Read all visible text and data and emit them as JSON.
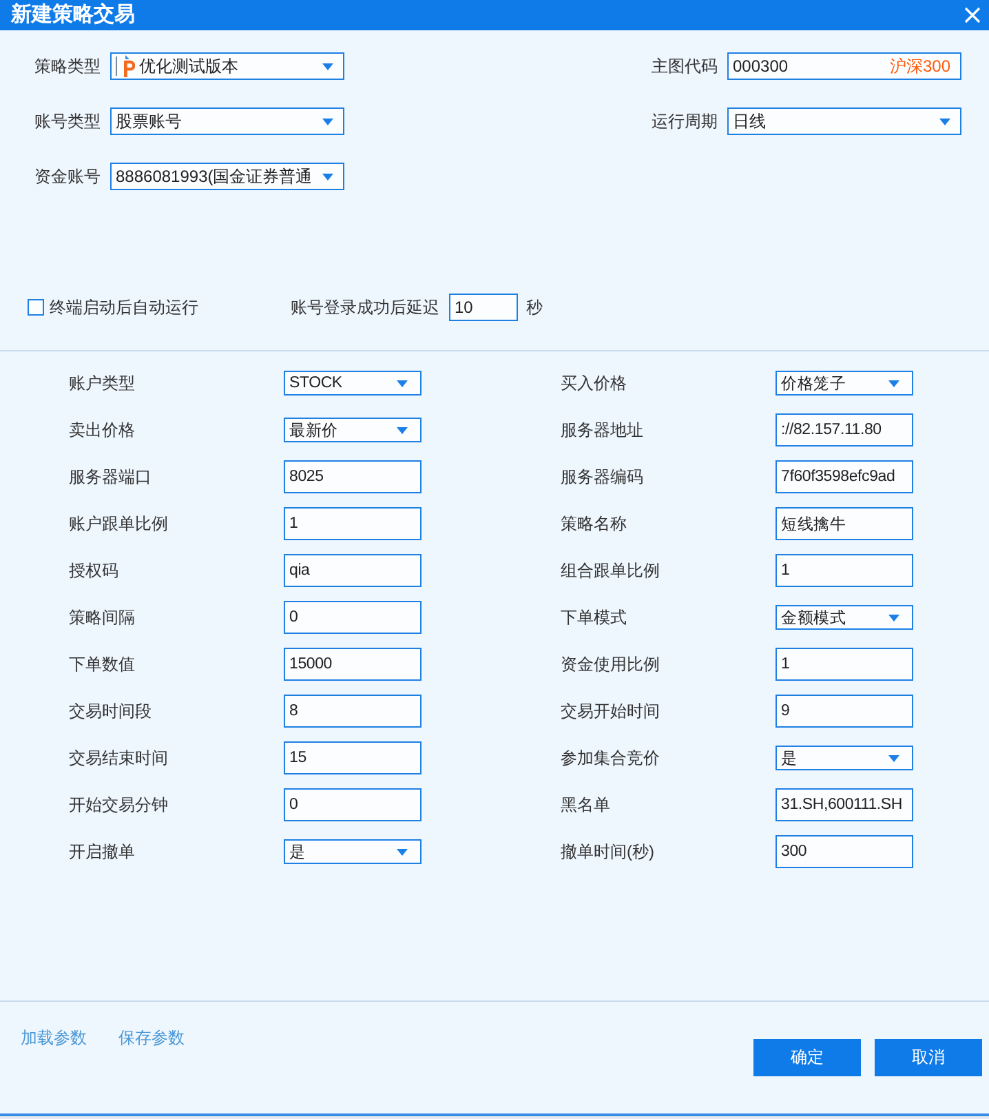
{
  "window": {
    "title": "新建策略交易"
  },
  "top_form": [
    [
      {
        "label": "策略类型",
        "kind": "dropdown",
        "icon": true,
        "value": "优化测试版本"
      },
      {
        "label": "主图代码",
        "kind": "input",
        "icon": false,
        "value": "000300",
        "suffix": "沪深300"
      }
    ],
    [
      {
        "label": "账号类型",
        "kind": "dropdown",
        "icon": false,
        "value": "股票账号"
      },
      {
        "label": "运行周期",
        "kind": "dropdown",
        "icon": false,
        "value": "日线"
      }
    ],
    [
      {
        "label": "资金账号",
        "kind": "dropdown",
        "icon": false,
        "value": "8886081993(国金证券普通"
      }
    ]
  ],
  "auto_run": {
    "label": "终端启动后自动运行",
    "checked": false
  },
  "login_delay": {
    "label": "账号登录成功后延迟",
    "value": "10",
    "unit": "秒"
  },
  "params": [
    {
      "label": "账户类型",
      "kind": "dropdown",
      "value": "STOCK"
    },
    {
      "label": "买入价格",
      "kind": "dropdown",
      "value": "价格笼子"
    },
    {
      "label": "卖出价格",
      "kind": "dropdown",
      "value": "最新价"
    },
    {
      "label": "服务器地址",
      "kind": "input",
      "value": "://82.157.11.80"
    },
    {
      "label": "服务器端口",
      "kind": "input",
      "value": "8025"
    },
    {
      "label": "服务器编码",
      "kind": "input",
      "value": "7f60f3598efc9ad"
    },
    {
      "label": "账户跟单比例",
      "kind": "input",
      "value": "1"
    },
    {
      "label": "策略名称",
      "kind": "input",
      "value": "短线擒牛"
    },
    {
      "label": "授权码",
      "kind": "input",
      "value": "qia"
    },
    {
      "label": "组合跟单比例",
      "kind": "input",
      "value": "1"
    },
    {
      "label": "策略间隔",
      "kind": "input",
      "value": "0"
    },
    {
      "label": "下单模式",
      "kind": "dropdown",
      "value": "金额模式"
    },
    {
      "label": "下单数值",
      "kind": "input",
      "value": "15000"
    },
    {
      "label": "资金使用比例",
      "kind": "input",
      "value": "1"
    },
    {
      "label": "交易时间段",
      "kind": "input",
      "value": "8"
    },
    {
      "label": "交易开始时间",
      "kind": "input",
      "value": "9"
    },
    {
      "label": "交易结束时间",
      "kind": "input",
      "value": "15"
    },
    {
      "label": "参加集合竞价",
      "kind": "dropdown",
      "value": "是"
    },
    {
      "label": "开始交易分钟",
      "kind": "input",
      "value": "0"
    },
    {
      "label": "黑名单",
      "kind": "input",
      "value": "31.SH,600111.SH"
    },
    {
      "label": "开启撤单",
      "kind": "dropdown",
      "value": "是"
    },
    {
      "label": "撤单时间(秒)",
      "kind": "input",
      "value": "300"
    }
  ],
  "footer": {
    "links": [
      "加载参数",
      "保存参数"
    ],
    "buttons": [
      "确定",
      "取消"
    ]
  }
}
